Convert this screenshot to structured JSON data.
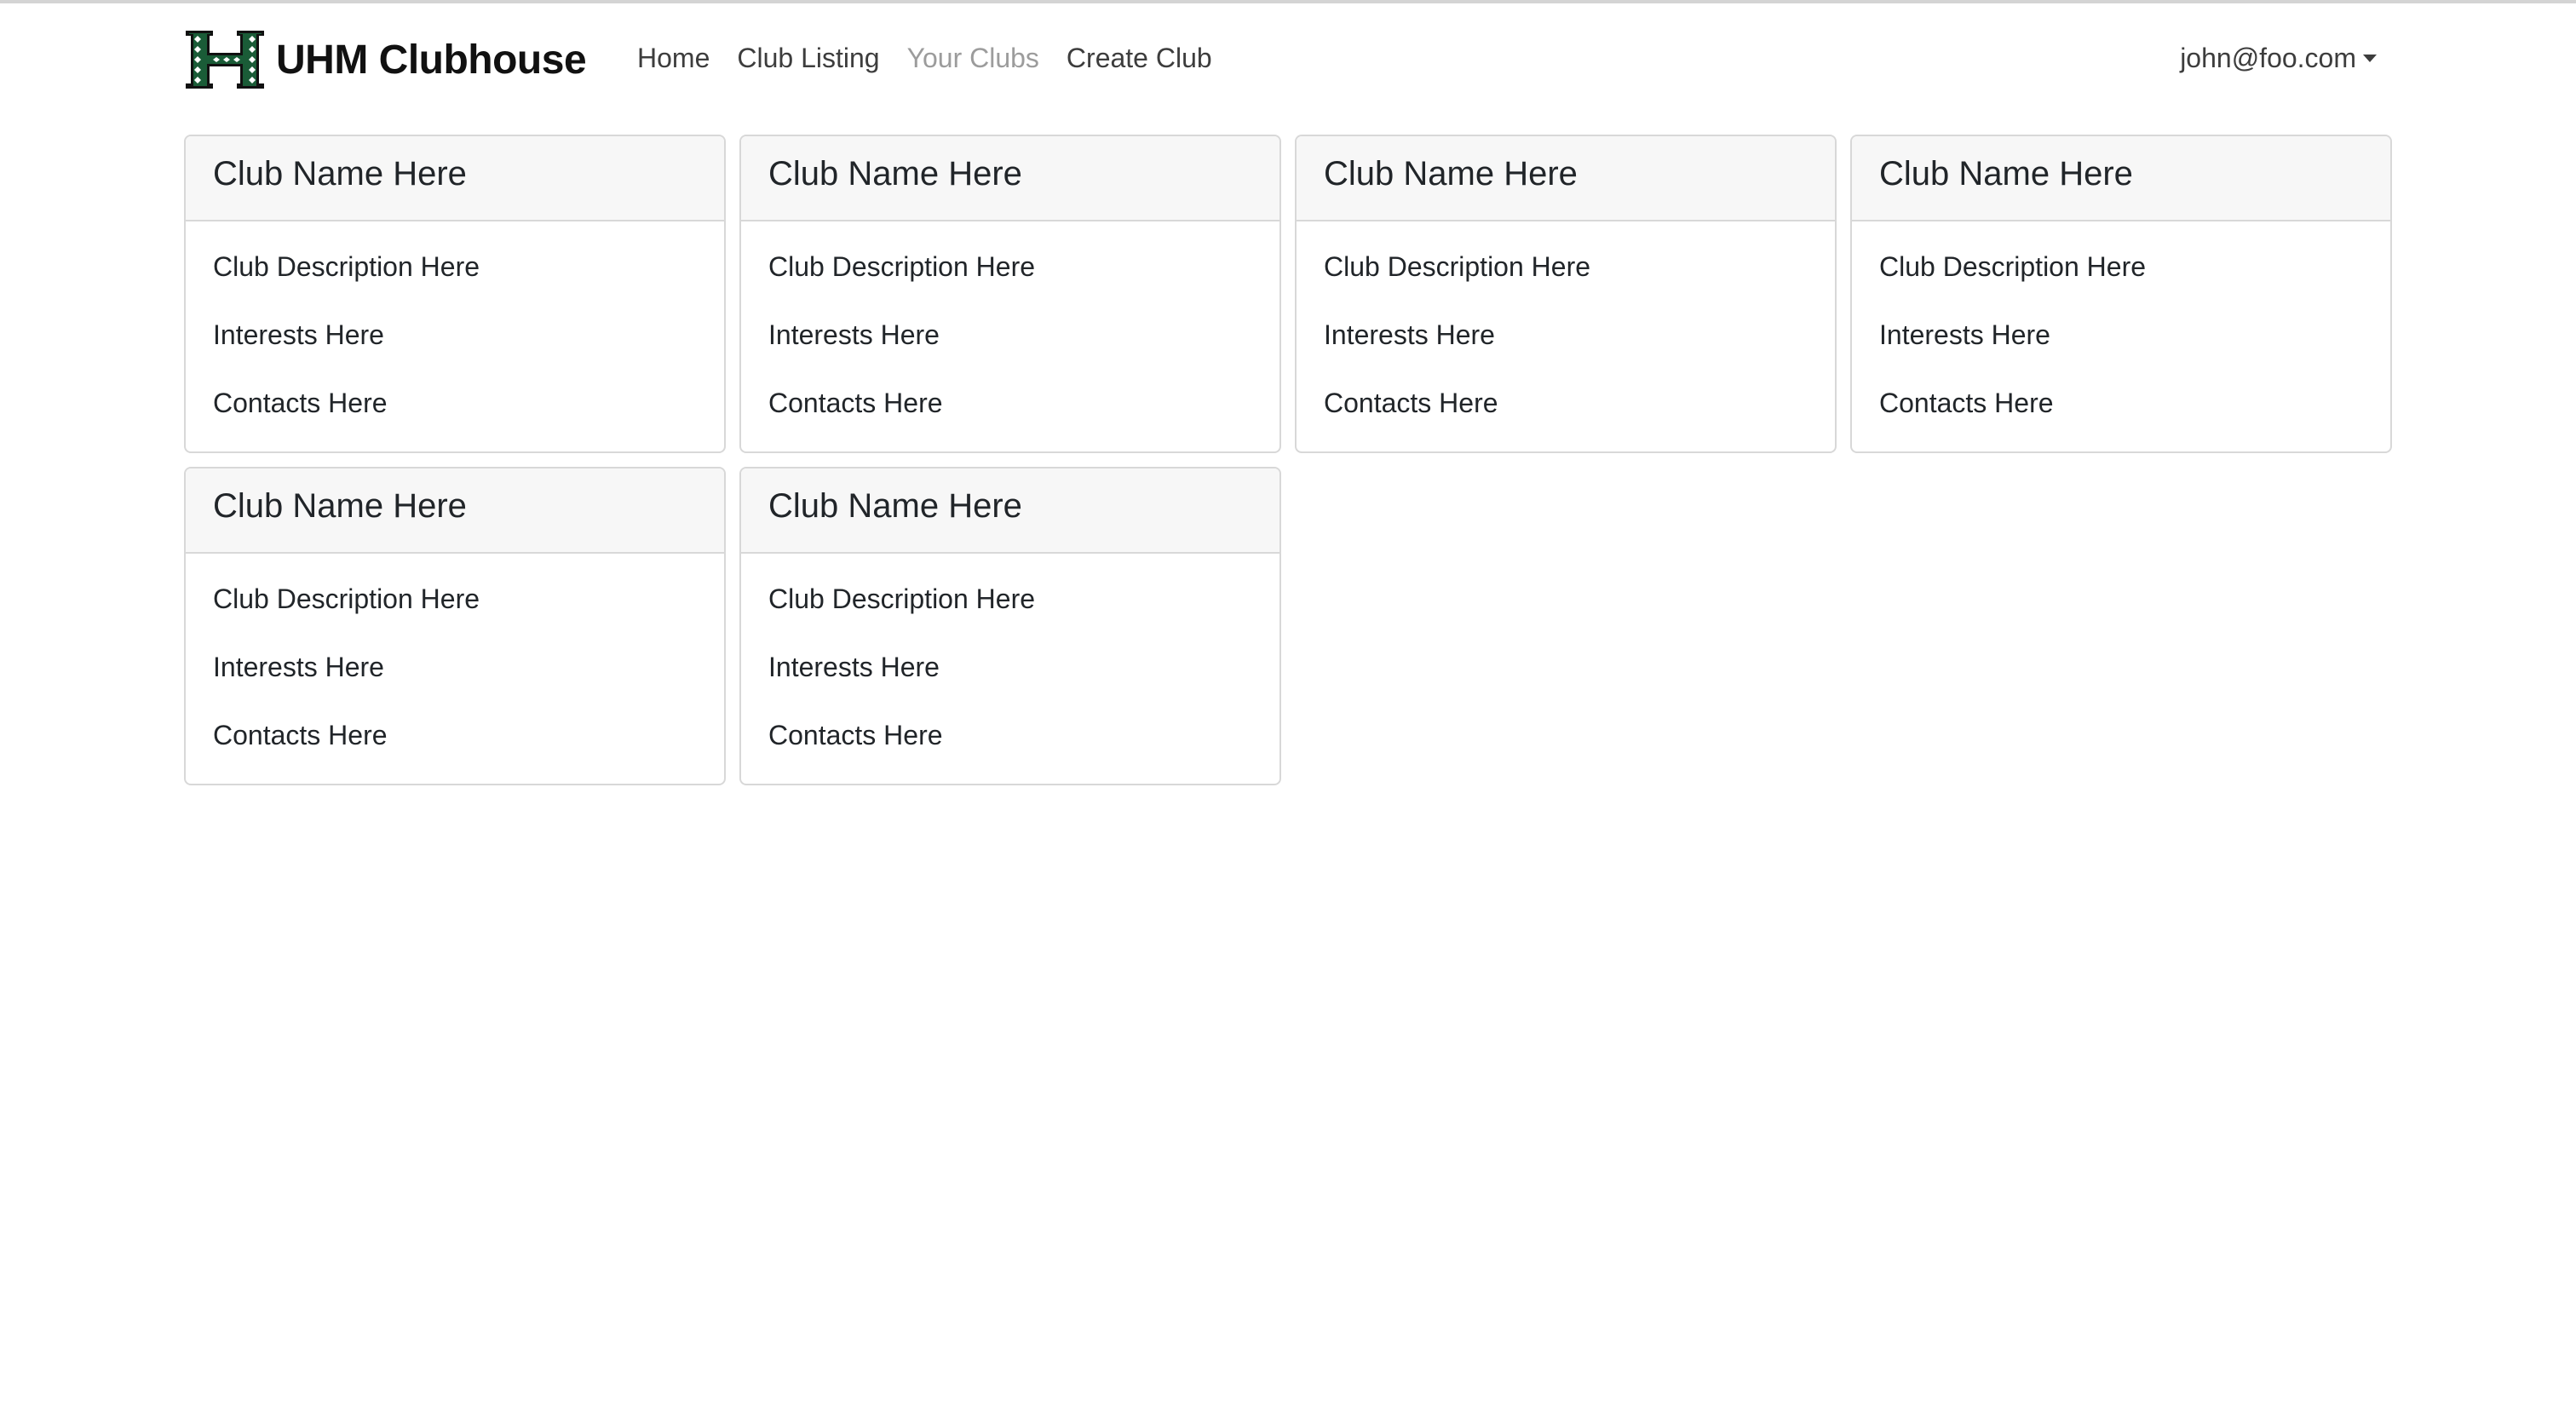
{
  "brand": {
    "name": "UHM Clubhouse",
    "logo_icon": "uh-h-logo-icon",
    "logo_color": "#1a5c37"
  },
  "nav": {
    "links": [
      {
        "label": "Home",
        "active": false
      },
      {
        "label": "Club Listing",
        "active": false
      },
      {
        "label": "Your Clubs",
        "active": true
      },
      {
        "label": "Create Club",
        "active": false
      }
    ],
    "user": {
      "email": "john@foo.com",
      "icon": "caret-down-icon"
    }
  },
  "clubs": [
    {
      "name": "Club Name Here",
      "description": "Club Description Here",
      "interests": "Interests Here",
      "contacts": "Contacts Here"
    },
    {
      "name": "Club Name Here",
      "description": "Club Description Here",
      "interests": "Interests Here",
      "contacts": "Contacts Here"
    },
    {
      "name": "Club Name Here",
      "description": "Club Description Here",
      "interests": "Interests Here",
      "contacts": "Contacts Here"
    },
    {
      "name": "Club Name Here",
      "description": "Club Description Here",
      "interests": "Interests Here",
      "contacts": "Contacts Here"
    },
    {
      "name": "Club Name Here",
      "description": "Club Description Here",
      "interests": "Interests Here",
      "contacts": "Contacts Here"
    },
    {
      "name": "Club Name Here",
      "description": "Club Description Here",
      "interests": "Interests Here",
      "contacts": "Contacts Here"
    }
  ]
}
